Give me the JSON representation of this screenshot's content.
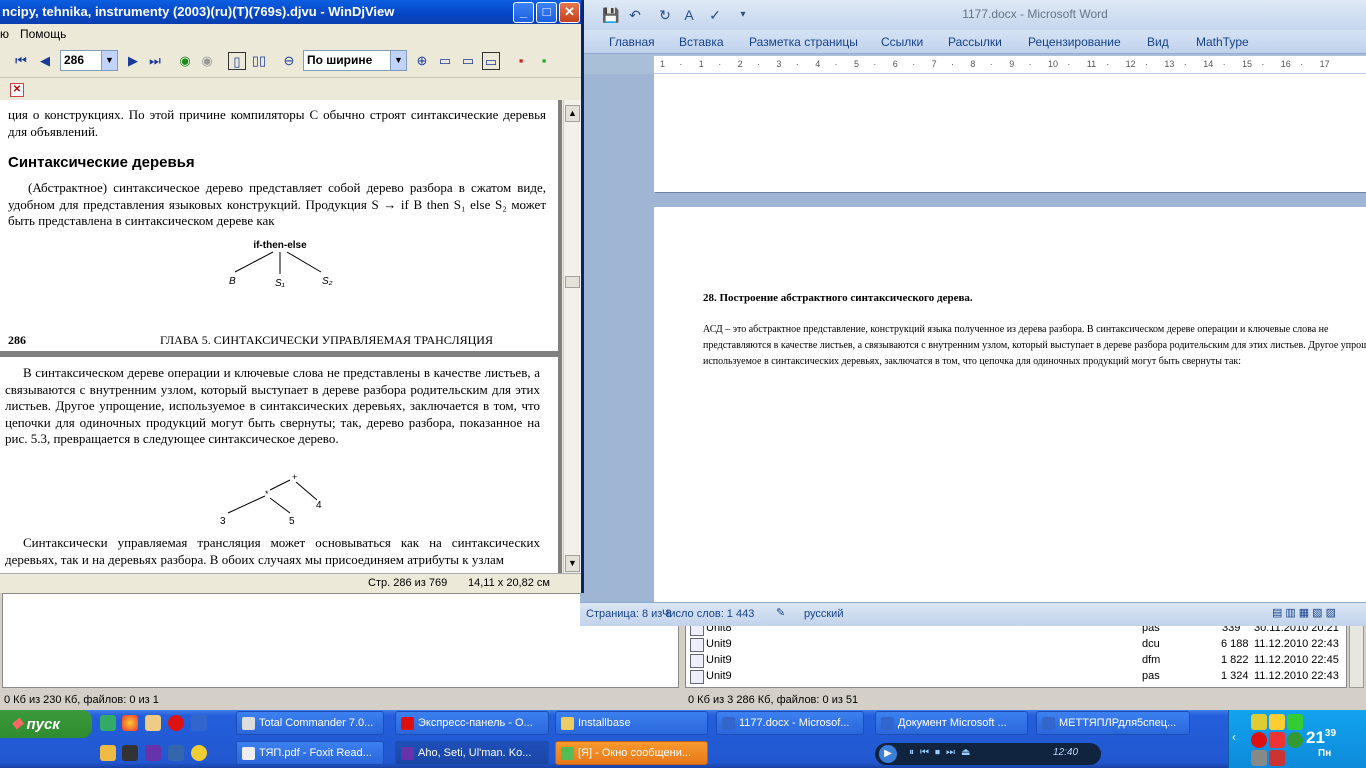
{
  "word": {
    "title": "1177.docx - Microsoft Word",
    "tabs": [
      "Главная",
      "Вставка",
      "Разметка страницы",
      "Ссылки",
      "Рассылки",
      "Рецензирование",
      "Вид",
      "MathType"
    ],
    "ruler_marks": [
      "1",
      "·",
      "1",
      "·",
      "2",
      "·",
      "3",
      "·",
      "4",
      "·",
      "5",
      "·",
      "6",
      "·",
      "7",
      "·",
      "8",
      "·",
      "9",
      "·",
      "10",
      "·",
      "11",
      "·",
      "12",
      "·",
      "13",
      "·",
      "14",
      "·",
      "15",
      "·",
      "16",
      "·",
      "17"
    ],
    "heading": "28. Построение абстрактного  синтаксического  дерева.",
    "paragraph": "АСД – это абстрактное  представление,  конструкций  языка полученное  из дерева разбора. В синтаксическом  дереве операции и ключевые слова не представляются  в качестве листьев, а связываются с внутренним  узлом, который выступает  в дереве разбора родительским для этих листьев. Другое упрощение,  используемое в синтаксических  деревьях, заключатся  в том, что цепочка для одиночных  продукций могут быть  свернуты  так:",
    "status": {
      "page": "Страница: 8 из 8",
      "words": "Число слов: 1 443",
      "lang": "русский"
    }
  },
  "djview": {
    "title": "ncipy, tehnika, instrumenty (2003)(ru)(T)(769s).djvu - WinDjView",
    "menu": [
      "ю",
      "Помощь"
    ],
    "page_number": "286",
    "zoom": "По ширине",
    "page1": {
      "top_text": "ция о конструкциях. По этой причине компиляторы С обычно строят синтаксические деревья для объявлений.",
      "section_title": "Синтаксические деревья",
      "para": "(Абстрактное) синтаксическое дерево представляет собой дерево разбора в сжатом виде, удобном для представления языковых конструкций. Продукция S → if B then S₁ else S₂ может быть представлена в синтаксическом дереве как",
      "tree1": {
        "root": "if-then-else",
        "children": [
          "B",
          "S₁",
          "S₂"
        ]
      },
      "footer_page": "286",
      "footer_chapter": "ГЛАВА 5. СИНТАКСИЧЕСКИ УПРАВЛЯЕМАЯ ТРАНСЛЯЦИЯ"
    },
    "page2": {
      "para1": "В синтаксическом дереве операции и ключевые слова не представлены в качестве листьев, а связываются с внутренним узлом, который выступает в дереве разбора родительским для этих листьев. Другое упрощение, используемое в синтаксических деревьях, заключается в том, что цепочки для одиночных продукций могут быть свернуты; так, дерево разбора, показанное на рис. 5.3, превращается в следующее синтаксическое дерево.",
      "tree2": {
        "root": "+",
        "inner": "*",
        "leaves": [
          "3",
          "5",
          "4"
        ]
      },
      "para2": "Синтаксически управляемая трансляция может основываться как на синтаксических деревьях, так и на деревьях разбора. В обоих случаях мы присоединяем атрибуты к узлам"
    },
    "status": {
      "page": "Стр. 286 из 769",
      "size": "14,11 x 20,82 см"
    }
  },
  "totalcmd": {
    "files": [
      {
        "name": "Unit8",
        "ext": "pas",
        "size": "339",
        "date": "30.11.2010 20:21"
      },
      {
        "name": "Unit9",
        "ext": "dcu",
        "size": "6 188",
        "date": "11.12.2010 22:43"
      },
      {
        "name": "Unit9",
        "ext": "dfm",
        "size": "1 822",
        "date": "11.12.2010 22:45"
      },
      {
        "name": "Unit9",
        "ext": "pas",
        "size": "1 324",
        "date": "11.12.2010 22:43"
      }
    ],
    "status_left": "0 Кб из 230 Кб, файлов: 0 из 1",
    "status_right": "0 Кб из 3 286 Кб, файлов: 0 из 51"
  },
  "taskbar": {
    "start": "пуск",
    "row1": [
      "Total Commander 7.0...",
      "Экспресс-панель - О...",
      "Installbase",
      "1177.docx - Microsof...",
      "Документ Microsoft ...",
      "МЕТТЯПЛРдля5спец..."
    ],
    "row2": [
      "ТЯП.pdf - Foxit Read...",
      "Aho, Seti, Ul'man. Ko...",
      "[Я] - Окно сообщени..."
    ],
    "player_time": "12:40",
    "clock": "21",
    "clock_minutes": "39",
    "clock_day": "Пн"
  }
}
